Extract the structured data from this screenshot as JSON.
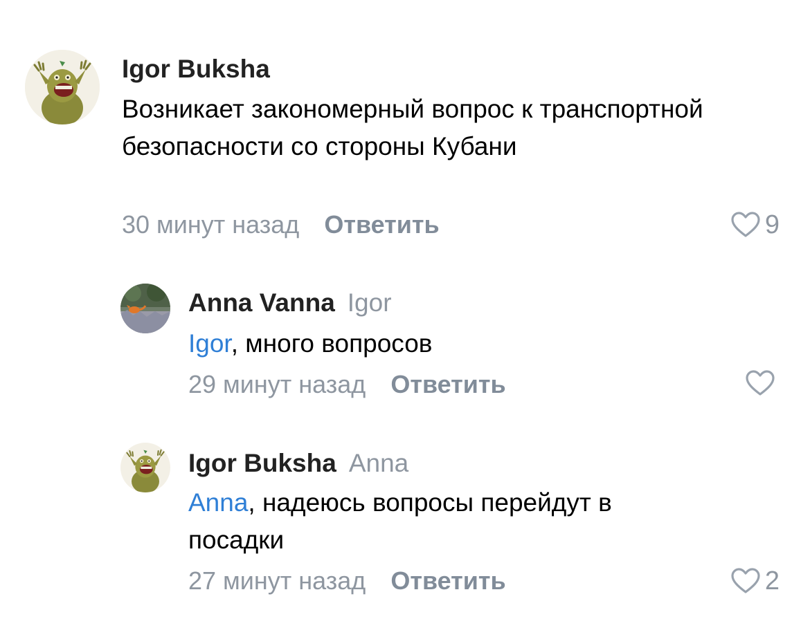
{
  "comments": [
    {
      "author": "Igor Buksha",
      "reply_to": "",
      "mention": "",
      "text": "Возникает закономерный вопрос к транспортной безопасности со стороны Кубани",
      "time": "30 минут назад",
      "reply_label": "Ответить",
      "likes": "9",
      "avatar_icon": "monster-avatar-icon"
    },
    {
      "author": "Anna Vanna",
      "reply_to": "Igor",
      "mention": "Igor",
      "text": ", много вопросов",
      "time": "29 минут назад",
      "reply_label": "Ответить",
      "likes": "",
      "avatar_icon": "fox-photo-avatar-icon"
    },
    {
      "author": "Igor Buksha",
      "reply_to": "Anna",
      "mention": "Anna",
      "text": ", надеюсь вопросы перейдут в посадки",
      "time": "27 минут назад",
      "reply_label": "Ответить",
      "likes": "2",
      "avatar_icon": "monster-avatar-icon"
    }
  ],
  "colors": {
    "mention": "#2f7fd6",
    "secondary_text": "#8e96a0",
    "reply_button": "#818c99",
    "author": "#222222",
    "heart": "#99a2ad"
  }
}
